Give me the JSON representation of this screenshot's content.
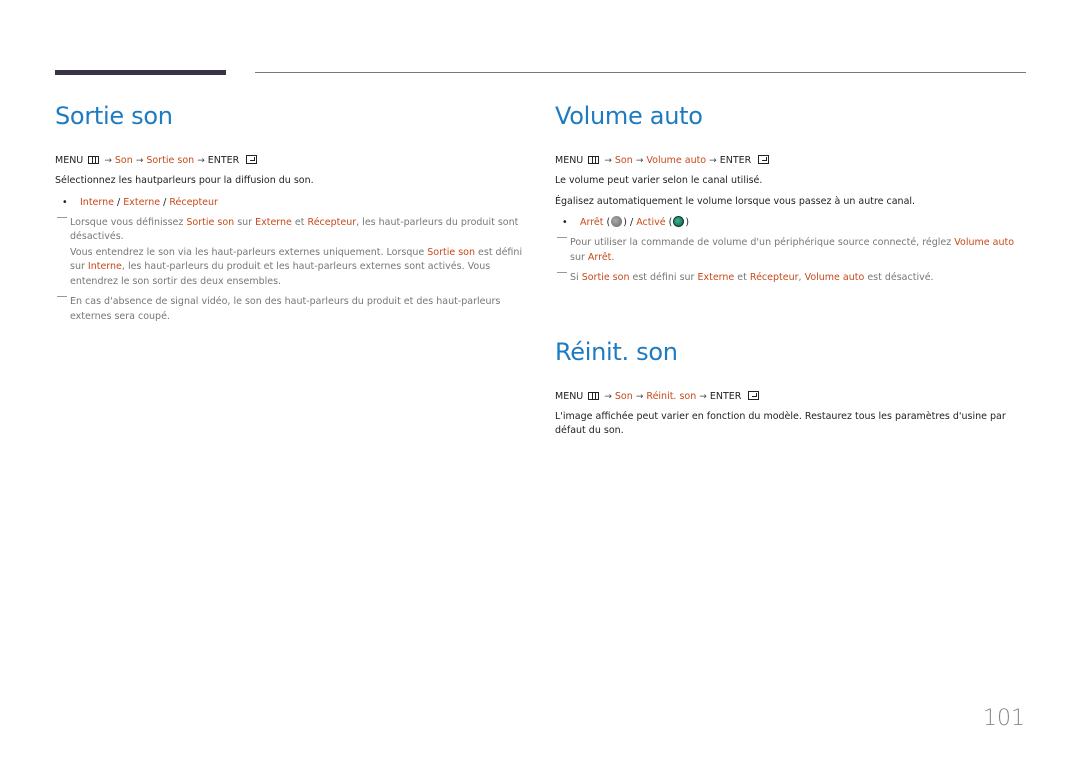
{
  "page_number": "101",
  "sections": {
    "sortie_son": {
      "title": "Sortie son",
      "path": {
        "menu": "MENU",
        "son": "Son",
        "item": "Sortie son",
        "enter": "ENTER"
      },
      "description": "Sélectionnez les hautparleurs pour la diffusion du son.",
      "options": [
        "Interne",
        "Externe",
        "Récepteur"
      ],
      "notes": [
        {
          "parts": [
            "Lorsque vous définissez ",
            "Sortie son",
            " sur ",
            "Externe",
            " et ",
            "Récepteur",
            ", les haut-parleurs du produit sont désactivés."
          ],
          "parts2": [
            "Vous entendrez le son via les haut-parleurs externes uniquement. Lorsque ",
            "Sortie son",
            " est défini sur ",
            "Interne",
            ", les haut-parleurs du produit et les haut-parleurs externes sont activés. Vous entendrez le son sortir des deux ensembles."
          ]
        },
        {
          "text": "En cas d'absence de signal vidéo, le son des haut-parleurs du produit et des haut-parleurs externes sera coupé."
        }
      ]
    },
    "volume_auto": {
      "title": "Volume auto",
      "path": {
        "menu": "MENU",
        "son": "Son",
        "item": "Volume auto",
        "enter": "ENTER"
      },
      "description1": "Le volume peut varier selon le canal utilisé.",
      "description2": "Égalisez automatiquement le volume lorsque vous passez à un autre canal.",
      "options": [
        "Arrêt",
        "Activé"
      ],
      "notes": [
        {
          "parts": [
            "Pour utiliser la commande de volume d'un périphérique source connecté, réglez ",
            "Volume auto",
            " sur ",
            "Arrêt",
            "."
          ]
        },
        {
          "parts": [
            "Si ",
            "Sortie son",
            " est défini sur ",
            "Externe",
            " et ",
            "Récepteur",
            ", ",
            "Volume auto",
            " est désactivé."
          ]
        }
      ]
    },
    "reinit_son": {
      "title": "Réinit. son",
      "path": {
        "menu": "MENU",
        "son": "Son",
        "item": "Réinit. son",
        "enter": "ENTER"
      },
      "description": "L'image affichée peut varier en fonction du modèle. Restaurez tous les paramètres d'usine par défaut du son."
    }
  },
  "colors": {
    "heading": "#1f7bc1",
    "highlight": "#c8491a",
    "note_text": "#777777"
  }
}
